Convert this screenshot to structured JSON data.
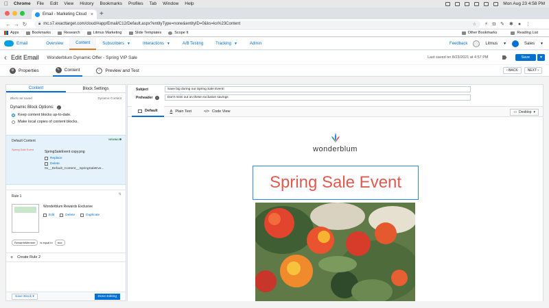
{
  "mac_menu": {
    "items": [
      "Chrome",
      "File",
      "Edit",
      "View",
      "History",
      "Bookmarks",
      "Profiles",
      "Tab",
      "Window",
      "Help"
    ],
    "clock": "Mon Aug 23  4:58 PM"
  },
  "browser": {
    "tab_title": "Email - Marketing Cloud",
    "url": "mc.s7.exacttarget.com/cloud/#app/Email/C12/Default.aspx?entityType=none&entityID=0&ks=ks%23Content",
    "bookmarks": [
      "Apps",
      "Bookmarks",
      "Research",
      "Litmus Marketing",
      "Slide Templates",
      "Scope It"
    ],
    "bookmarks_right": [
      "Other Bookmarks",
      "Reading List"
    ]
  },
  "sfmc_nav": {
    "app_name": "Email",
    "tabs": [
      {
        "label": "Overview",
        "dropdown": false
      },
      {
        "label": "Content",
        "dropdown": false
      },
      {
        "label": "Subscribers",
        "dropdown": true
      },
      {
        "label": "Interactions",
        "dropdown": true
      },
      {
        "label": "A/B Testing",
        "dropdown": false
      },
      {
        "label": "Tracking",
        "dropdown": true
      },
      {
        "label": "Admin",
        "dropdown": false
      }
    ],
    "feedback": "Feedback",
    "account": "Litmus",
    "business_unit": "Sales"
  },
  "edit_header": {
    "title": "Edit Email",
    "email_name": "Wonderblum Dynamic Offer - Spring VIP Sale",
    "last_saved": "Last saved on 8/23/2021 at 4:57 PM",
    "save": "Save"
  },
  "steps": {
    "items": [
      {
        "num": "1",
        "label": "Properties"
      },
      {
        "num": "2",
        "label": "Content"
      },
      {
        "num": "3",
        "label": "Preview and Test"
      }
    ],
    "back": "BACK",
    "next": "NEXT"
  },
  "left_panel": {
    "tabs": [
      "Content",
      "Block Settings"
    ],
    "status": "Block not saved",
    "block_type": "Dynamic Content",
    "options_label": "Dynamic Block Options:",
    "options": [
      {
        "label": "Keep content blocks up-to-date.",
        "selected": true
      },
      {
        "label": "Make local copies of content blocks.",
        "selected": false
      }
    ],
    "default_content": {
      "label": "Default Content",
      "badge": "VIEWING",
      "thumb_text": "Spring Sale Event",
      "file_name": "SpringSaleEvent copy.png",
      "replace": "Replace",
      "delete": "Delete",
      "path": "01__Default_Content__SpringSaleEve..."
    },
    "rule1": {
      "label": "Rule 1",
      "name": "Wonderblum Rewards Exclusive",
      "edit": "Edit",
      "delete": "Delete",
      "duplicate": "Duplicate",
      "cond_field": "RewardsMember",
      "cond_op": "is equal to",
      "cond_value": "true"
    },
    "create_rule": "Create Rule 2",
    "save_block": "Save Block",
    "done_editing": "Done Editing"
  },
  "editor": {
    "subject_label": "Subject",
    "subject_value": "Save big during our Spring Sale Event!",
    "preheader_label": "Preheader",
    "preheader_value": "Don't miss out on these exclusive savings",
    "view_tabs": [
      "Default",
      "Plain Text",
      "Code View"
    ],
    "device": "Desktop",
    "brand": "wonderblum",
    "hero_title": "Spring Sale Event"
  },
  "colors": {
    "accent": "#0070d2",
    "hero_text": "#e05a4f",
    "selection_border": "#2e87d8",
    "nav_active": "#e07a14"
  }
}
